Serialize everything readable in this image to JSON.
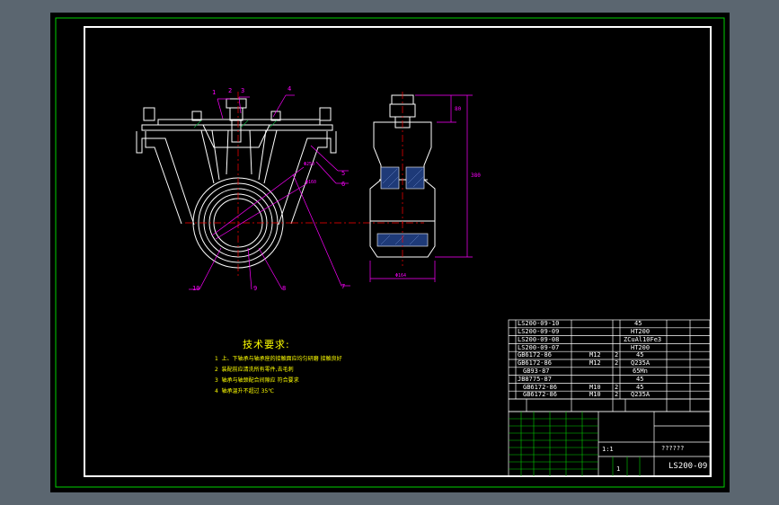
{
  "technical_requirements": {
    "title": "技术要求:",
    "items": [
      {
        "num": "1",
        "text": "上、下轴承与轴承座的接触面应均匀研磨 接触良好"
      },
      {
        "num": "2",
        "text": "装配前应清洗所有零件,去毛刺"
      },
      {
        "num": "3",
        "text": "轴承与轴颈配合间隙应 符合要求"
      },
      {
        "num": "4",
        "text": "轴承温升不超过 35℃"
      }
    ]
  },
  "balloons": [
    "1",
    "2",
    "3",
    "4",
    "5",
    "6",
    "7",
    "8",
    "9",
    "10"
  ],
  "dimensions": {
    "top_dim": "80",
    "overall_height": "380",
    "bottom_width": "Φ164",
    "radial_1": "Φ250",
    "radial_2": "Φ160"
  },
  "bom": [
    {
      "code": "LS200-09-10",
      "name": "",
      "qty": "",
      "material": "45"
    },
    {
      "code": "LS200-09-09",
      "name": "",
      "qty": "",
      "material": "HT200"
    },
    {
      "code": "LS200-09-08",
      "name": "",
      "qty": "",
      "material": "ZCuAl10Fe3"
    },
    {
      "code": "LS200-09-07",
      "name": "",
      "qty": "",
      "material": "HT200"
    },
    {
      "code": "GB6172-86",
      "name": "M12",
      "qty": "2",
      "material": "45"
    },
    {
      "code": "GB6172-86",
      "name": "M12",
      "qty": "2",
      "material": "Q235A"
    },
    {
      "code": "GB93-87",
      "name": "",
      "qty": "",
      "material": "65Mn"
    },
    {
      "code": "JB8775-87",
      "name": "",
      "qty": "",
      "material": "45"
    },
    {
      "code": "GB6172-86",
      "name": "M10",
      "qty": "2",
      "material": "45"
    },
    {
      "code": "GB6172-86",
      "name": "M10",
      "qty": "2",
      "material": "Q235A"
    }
  ],
  "title_block": {
    "drawing_no": "LS200-09",
    "part_name": "??????",
    "scale_row": "1:1",
    "sheet": "1"
  },
  "colors": {
    "frame": "#ffffff",
    "outer_frame": "#00ff00",
    "geometry": "#ffffff",
    "dimension": "#ff00ff",
    "centerline": "#ff0000",
    "section_fill": "#1e3a78",
    "text": "#ffff00"
  }
}
